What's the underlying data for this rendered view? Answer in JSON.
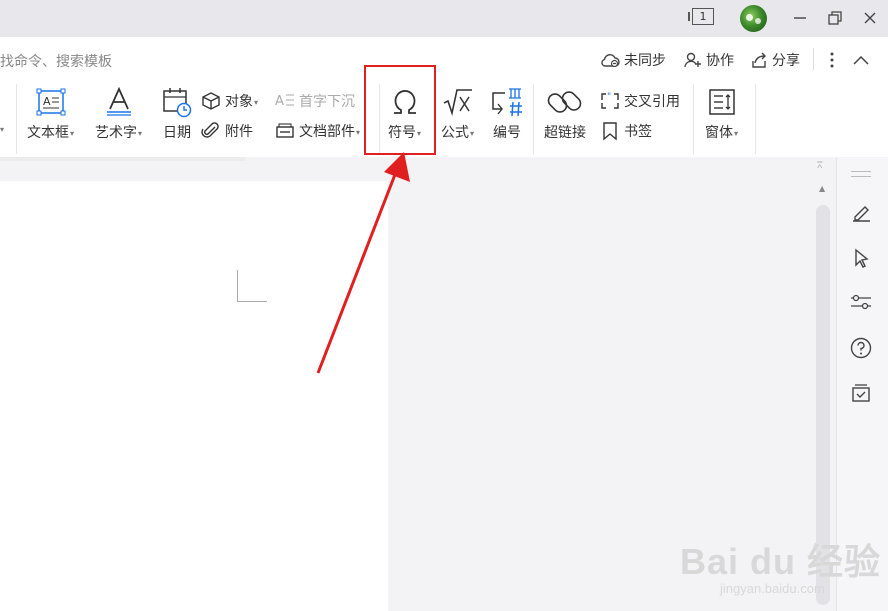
{
  "titlebar": {
    "tab_count": "1"
  },
  "search": {
    "hint": "找命令、搜索模板"
  },
  "top_actions": {
    "sync": "未同步",
    "collab": "协作",
    "share": "分享"
  },
  "ribbon": {
    "textbox": "文本框",
    "wordart": "艺术字",
    "date": "日期",
    "object": "对象",
    "attachment": "附件",
    "dropcap": "首字下沉",
    "docparts": "文档部件",
    "symbol": "符号",
    "formula": "公式",
    "numbering": "编号",
    "hyperlink": "超链接",
    "crossref": "交叉引用",
    "bookmark": "书签",
    "window": "窗体"
  },
  "watermark": {
    "main": "Bai du 经验",
    "sub": "jingyan.baidu.com"
  },
  "colors": {
    "accent": "#1a73e8",
    "highlight": "#e02020"
  }
}
